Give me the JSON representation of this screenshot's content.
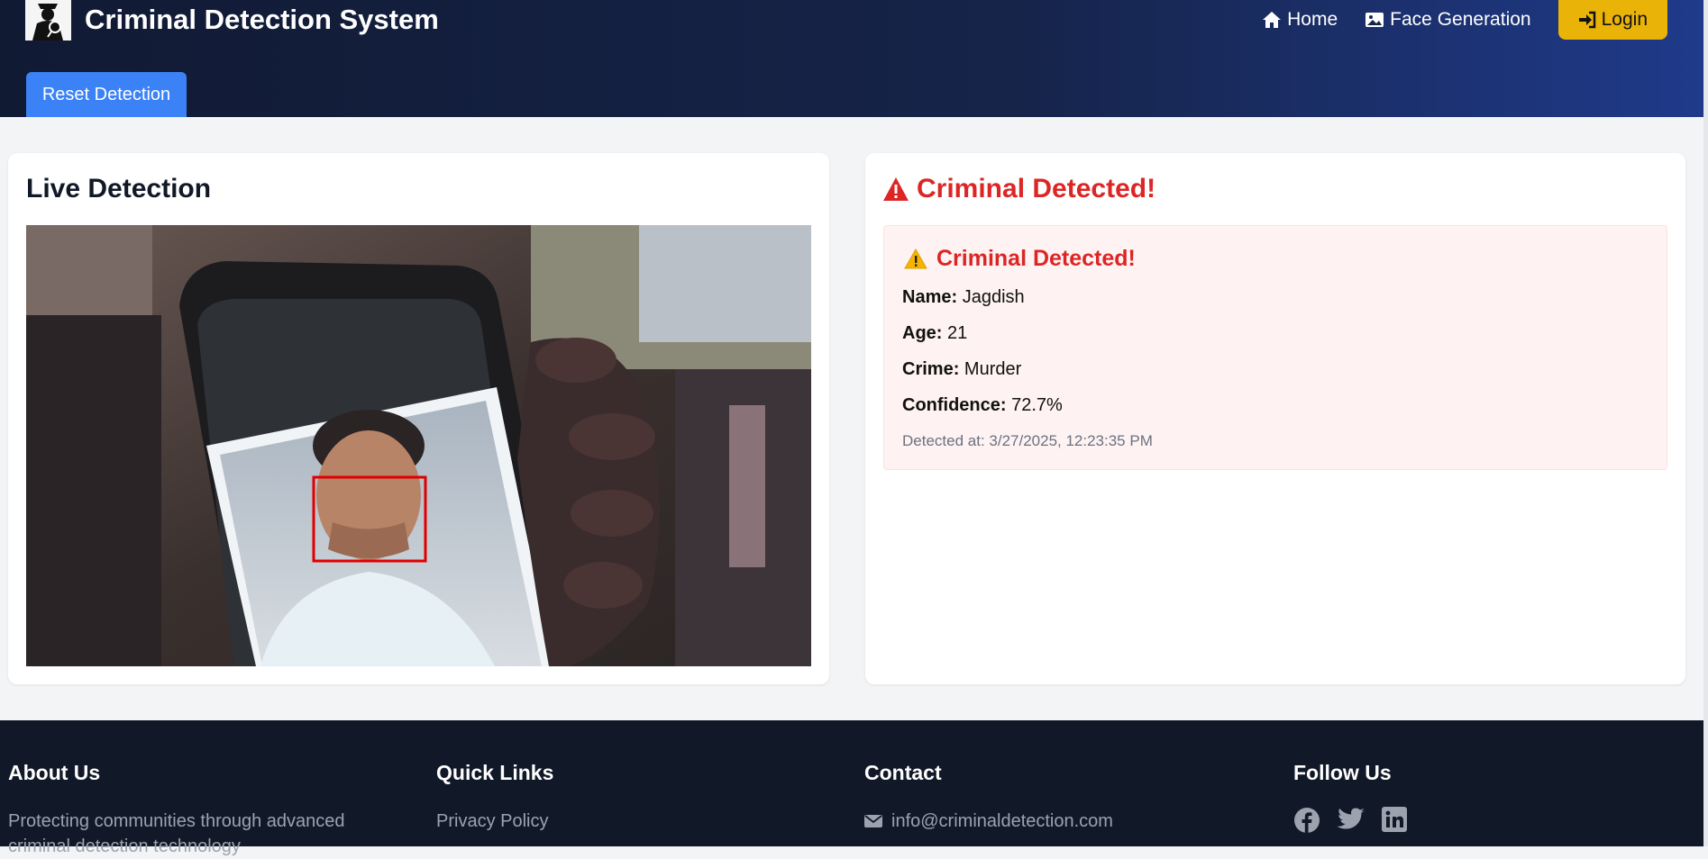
{
  "header": {
    "brand": "Criminal Detection System",
    "nav": [
      {
        "label": "Home",
        "icon": "home-icon"
      },
      {
        "label": "Face Generation",
        "icon": "image-icon"
      }
    ],
    "login_label": "Login",
    "reset_label": "Reset Detection"
  },
  "live": {
    "title": "Live Detection"
  },
  "result": {
    "title": "Criminal Detected!",
    "alert_title": "Criminal Detected!",
    "fields": [
      {
        "label": "Name:",
        "value": "Jagdish"
      },
      {
        "label": "Age:",
        "value": "21"
      },
      {
        "label": "Crime:",
        "value": "Murder"
      },
      {
        "label": "Confidence:",
        "value": "72.7%"
      }
    ],
    "detected_at": "Detected at: 3/27/2025, 12:23:35 PM"
  },
  "footer": {
    "about": {
      "title": "About Us",
      "text": "Protecting communities through advanced criminal detection technology"
    },
    "links": {
      "title": "Quick Links",
      "items": [
        "Privacy Policy"
      ]
    },
    "contact": {
      "title": "Contact",
      "email": "info@criminaldetection.com"
    },
    "follow": {
      "title": "Follow Us",
      "icons": [
        "facebook-icon",
        "twitter-icon",
        "linkedin-icon"
      ]
    }
  },
  "colors": {
    "accent": "#3b82f6",
    "login": "#eab308",
    "danger": "#dc2626",
    "footer_bg": "#111827"
  }
}
